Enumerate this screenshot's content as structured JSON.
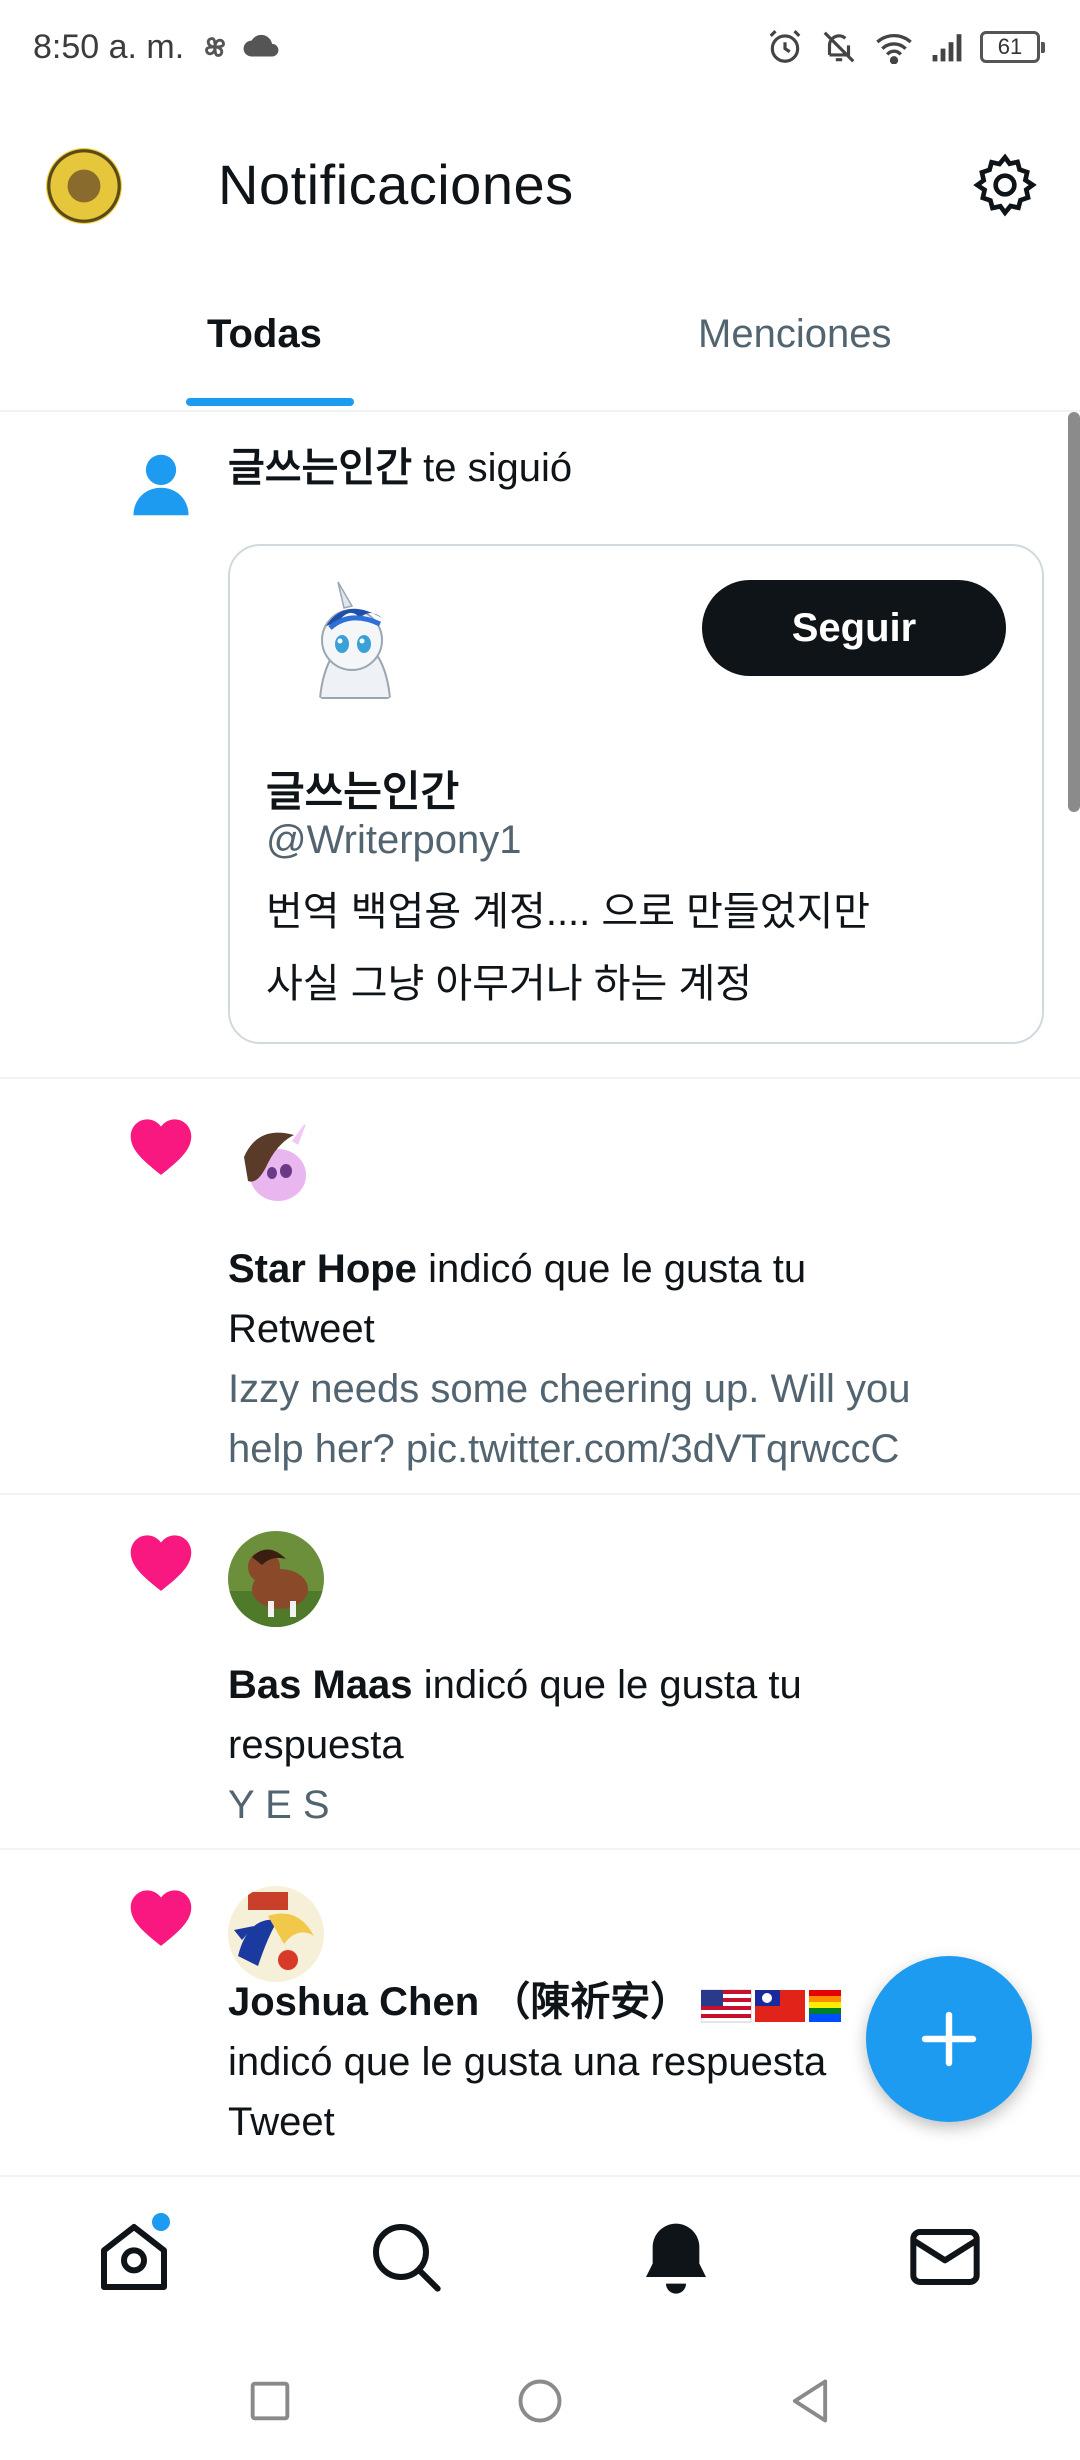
{
  "status_bar": {
    "time": "8:50 a. m.",
    "battery": "61",
    "icons": [
      "pinwheel-icon",
      "cloud-icon",
      "alarm-icon",
      "bell-off-icon",
      "wifi-icon",
      "signal-icon",
      "battery-icon"
    ]
  },
  "header": {
    "title": "Notificaciones"
  },
  "tabs": [
    {
      "label": "Todas",
      "selected": true
    },
    {
      "label": "Menciones",
      "selected": false
    }
  ],
  "notifications": [
    {
      "type": "follow",
      "actor": "글쓰는인간",
      "action": "te siguió",
      "card": {
        "name": "글쓰는인간",
        "handle": "@Writerpony1",
        "bio_line1": "번역 백업용 계정.... 으로 만들었지만",
        "bio_line2": "사실 그냥 아무거나 하는 계정",
        "follow_label": "Seguir"
      }
    },
    {
      "type": "like",
      "actor": "Star Hope",
      "action_line1": "indicó que le gusta tu",
      "action_line2": "Retweet",
      "preview_line1": "Izzy needs some cheering up. Will you",
      "preview_line2": "help her? pic.twitter.com/3dVTqrwccC"
    },
    {
      "type": "like",
      "actor": "Bas Maas",
      "action_line1": "indicó que le gusta tu",
      "action_line2": "respuesta",
      "preview_line1": "Y E S"
    },
    {
      "type": "like",
      "actor": "Joshua Chen （陳祈安）",
      "action_line1": "indicó que le gusta una respuesta",
      "action_line2": "Tweet"
    }
  ],
  "fab": {
    "icon": "plus-icon"
  },
  "bottom_nav": [
    "home-icon",
    "search-icon",
    "bell-icon",
    "mail-icon"
  ],
  "colors": {
    "accent": "#1d9bf0",
    "like": "#f91880",
    "text": "#0f1419",
    "secondary_text": "#536471",
    "border": "#eff3f4"
  }
}
